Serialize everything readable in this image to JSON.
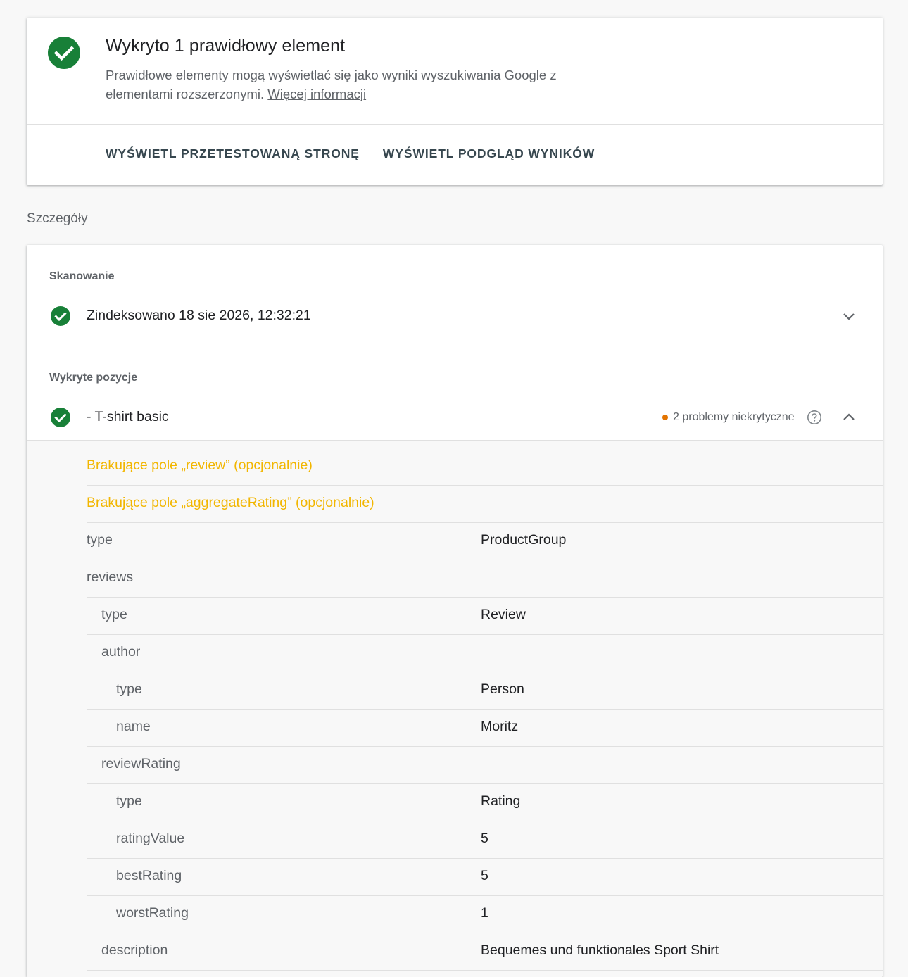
{
  "summary": {
    "title": "Wykryto 1 prawidłowy element",
    "description": "Prawidłowe elementy mogą wyświetlać się jako wyniki wyszukiwania Google z elementami rozszerzonymi.",
    "learn_more": "Więcej informacji",
    "actions": [
      "WYŚWIETL PRZETESTOWANĄ STRONĘ",
      "WYŚWIETL PODGLĄD WYNIKÓW"
    ]
  },
  "details_heading": "Szczegóły",
  "crawl": {
    "label": "Skanowanie",
    "status": "Zindeksowano 18 sie 2026, 12:32:21"
  },
  "detected": {
    "label": "Wykryte pozycje",
    "item_name": "- T-shirt basic",
    "issues_text": "2 problemy niekrytyczne",
    "warnings": [
      "Brakujące pole „review” (opcjonalnie)",
      "Brakujące pole „aggregateRating” (opcjonalnie)"
    ],
    "properties": [
      {
        "key": "type",
        "value": "ProductGroup",
        "level": 0
      },
      {
        "key": "reviews",
        "value": "",
        "level": 0
      },
      {
        "key": "type",
        "value": "Review",
        "level": 1
      },
      {
        "key": "author",
        "value": "",
        "level": 1
      },
      {
        "key": "type",
        "value": "Person",
        "level": 2
      },
      {
        "key": "name",
        "value": "Moritz",
        "level": 2
      },
      {
        "key": "reviewRating",
        "value": "",
        "level": 1
      },
      {
        "key": "type",
        "value": "Rating",
        "level": 2
      },
      {
        "key": "ratingValue",
        "value": "5",
        "level": 2
      },
      {
        "key": "bestRating",
        "value": "5",
        "level": 2
      },
      {
        "key": "worstRating",
        "value": "1",
        "level": 2
      },
      {
        "key": "description",
        "value": "Bequemes und funktionales Sport Shirt",
        "level": 1
      }
    ]
  },
  "colors": {
    "success": "#188038",
    "warning_text": "#f2b600",
    "warning_dot": "#e37400",
    "action_text": "#37474f"
  },
  "icons": {
    "status": "check-circle-icon",
    "collapse": "chevron-up-icon",
    "expand": "chevron-down-icon",
    "help": "help-circle-icon"
  }
}
